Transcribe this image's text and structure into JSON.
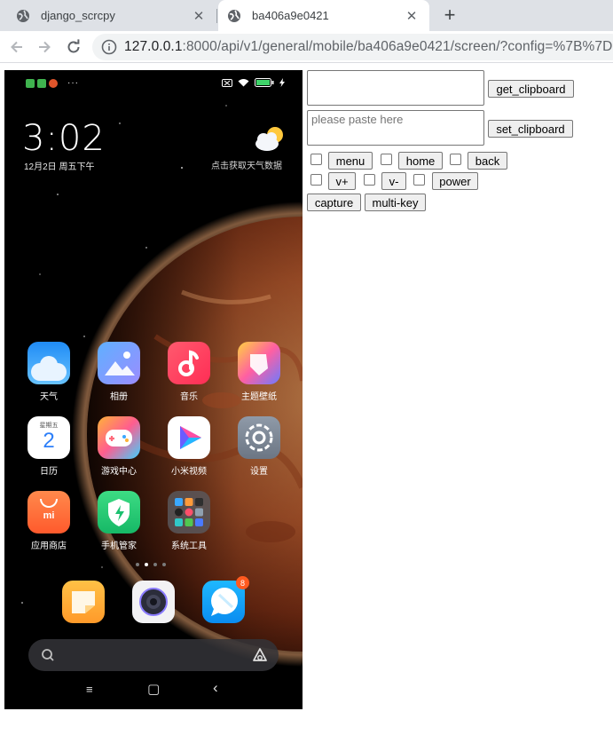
{
  "browser": {
    "tabs": [
      {
        "title": "django_scrcpy",
        "active": false
      },
      {
        "title": "ba406a9e0421",
        "active": true
      }
    ],
    "new_tab": "+",
    "url_host": "127.0.0.1",
    "url_rest": ":8000/api/v1/general/mobile/ba406a9e0421/screen/?config=%7B%7D"
  },
  "phone": {
    "status_dots": "···",
    "battery": "99",
    "time": "3:02",
    "date": "12月2日 周五下午",
    "weather_hint": "点击获取天气数据",
    "apps": [
      {
        "label": "天气",
        "icon": "weather-app-icon"
      },
      {
        "label": "相册",
        "icon": "gallery-app-icon"
      },
      {
        "label": "音乐",
        "icon": "music-app-icon"
      },
      {
        "label": "主题壁纸",
        "icon": "themes-app-icon"
      },
      {
        "label": "日历",
        "icon": "calendar-app-icon"
      },
      {
        "label": "游戏中心",
        "icon": "game-center-app-icon"
      },
      {
        "label": "小米视频",
        "icon": "mi-video-app-icon"
      },
      {
        "label": "设置",
        "icon": "settings-app-icon"
      },
      {
        "label": "应用商店",
        "icon": "app-store-icon"
      },
      {
        "label": "手机管家",
        "icon": "security-app-icon"
      },
      {
        "label": "系统工具",
        "icon": "system-tools-folder-icon"
      }
    ],
    "calendar_weekday": "星期五",
    "calendar_day": "2",
    "mi_logo": "mi",
    "dock": [
      {
        "icon": "notes-app-icon"
      },
      {
        "icon": "camera-app-icon"
      },
      {
        "icon": "messages-app-icon"
      }
    ],
    "messages_badge": "8",
    "nav": {
      "menu": "≡",
      "home": "▢",
      "back": "‹"
    }
  },
  "controls": {
    "clipboard_value": "",
    "paste_placeholder": "please paste here",
    "get_clipboard": "get_clipboard",
    "set_clipboard": "set_clipboard",
    "menu": "menu",
    "home": "home",
    "back": "back",
    "vol_up": "v+",
    "vol_down": "v-",
    "power": "power",
    "capture": "capture",
    "multi_key": "multi-key"
  }
}
